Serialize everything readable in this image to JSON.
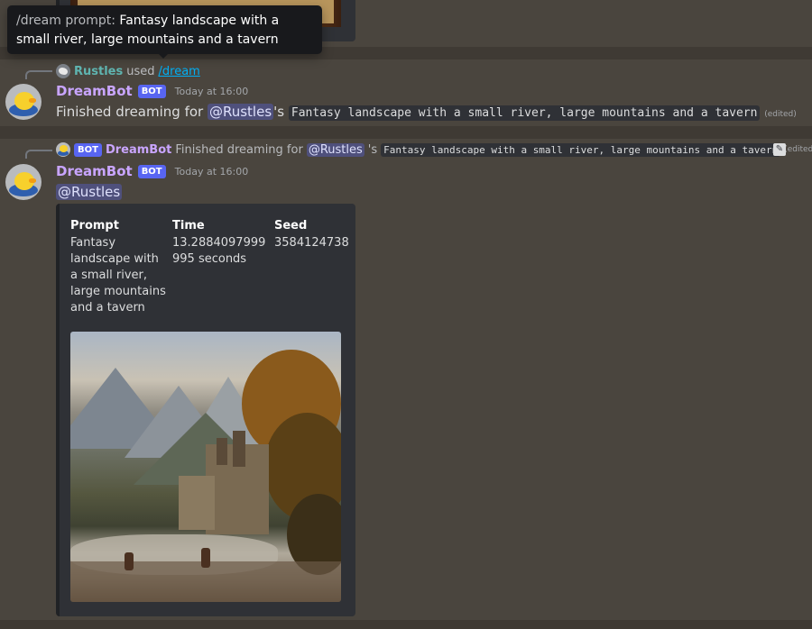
{
  "tooltip": {
    "label": "/dream prompt:",
    "value": "Fantasy landscape with a small river, large mountains and a tavern"
  },
  "message1": {
    "reply": {
      "user": "Rustles",
      "action": "used",
      "command": "/dream"
    },
    "author": "DreamBot",
    "bot_tag": "BOT",
    "timestamp": "Today at 16:00",
    "text_prefix": "Finished dreaming for",
    "mention": "@Rustles",
    "possessive": "'s",
    "prompt_code": "Fantasy landscape with a small river, large mountains and a tavern",
    "edited": "(edited)"
  },
  "message2": {
    "reply": {
      "bot_tag": "BOT",
      "author": "DreamBot",
      "text_prefix": "Finished dreaming for",
      "mention": "@Rustles",
      "possessive": "'s",
      "prompt_code": "Fantasy landscape with a small river, large mountains and a tavern",
      "edited": "(edited)"
    },
    "author": "DreamBot",
    "bot_tag": "BOT",
    "timestamp": "Today at 16:00",
    "mention": "@Rustles",
    "embed": {
      "fields": [
        {
          "name": "Prompt",
          "value": "Fantasy landscape with a small river, large mountains and a tavern"
        },
        {
          "name": "Time",
          "value": "13.2884097999995 seconds"
        },
        {
          "name": "Seed",
          "value": "3584124738"
        }
      ]
    }
  },
  "icons": {
    "edit": "pencil-icon"
  },
  "colors": {
    "background": "#4a453e",
    "embed_bg": "#2f3136",
    "username": "#c9a5ff",
    "bot_tag": "#5865f2",
    "mention_bg": "#5865f2"
  }
}
